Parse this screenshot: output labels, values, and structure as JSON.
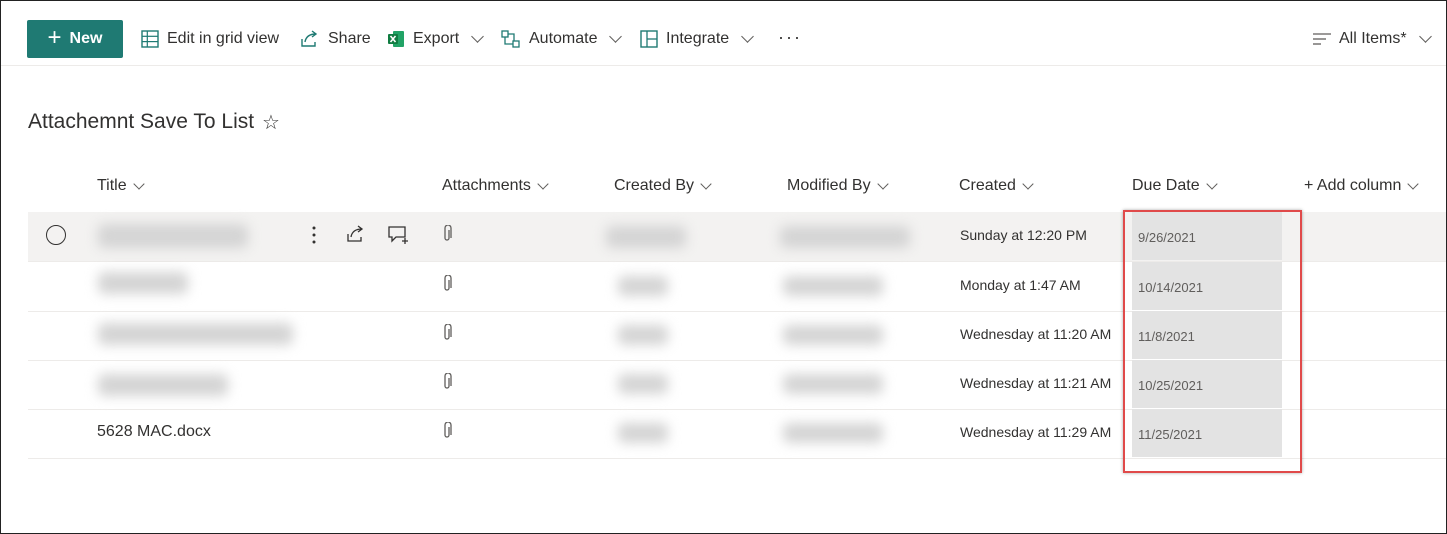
{
  "toolbar": {
    "new_label": "New",
    "edit_grid_label": "Edit in grid view",
    "share_label": "Share",
    "export_label": "Export",
    "automate_label": "Automate",
    "integrate_label": "Integrate",
    "more_label": "···",
    "view_label": "All Items*"
  },
  "list": {
    "title": "Attachemnt Save To List",
    "favorite_icon": "star-icon"
  },
  "columns": {
    "title": "Title",
    "attachments": "Attachments",
    "created_by": "Created By",
    "modified_by": "Modified By",
    "created": "Created",
    "due_date": "Due Date",
    "add_column": "+ Add column"
  },
  "rows": [
    {
      "title": "",
      "created": "Sunday at 12:20 PM",
      "due_date": "9/26/2021"
    },
    {
      "title": "",
      "created": "Monday at 1:47 AM",
      "due_date": "10/14/2021"
    },
    {
      "title": "",
      "created": "Wednesday at 11:20 AM",
      "due_date": "11/8/2021"
    },
    {
      "title": "",
      "created": "Wednesday at 11:21 AM",
      "due_date": "10/25/2021"
    },
    {
      "title": "5628 MAC.docx",
      "created": "Wednesday at 11:29 AM",
      "due_date": "11/25/2021"
    }
  ],
  "colors": {
    "accent": "#1f7a73",
    "highlight_border": "#e04a4a",
    "selected_row": "#f3f2f1"
  }
}
